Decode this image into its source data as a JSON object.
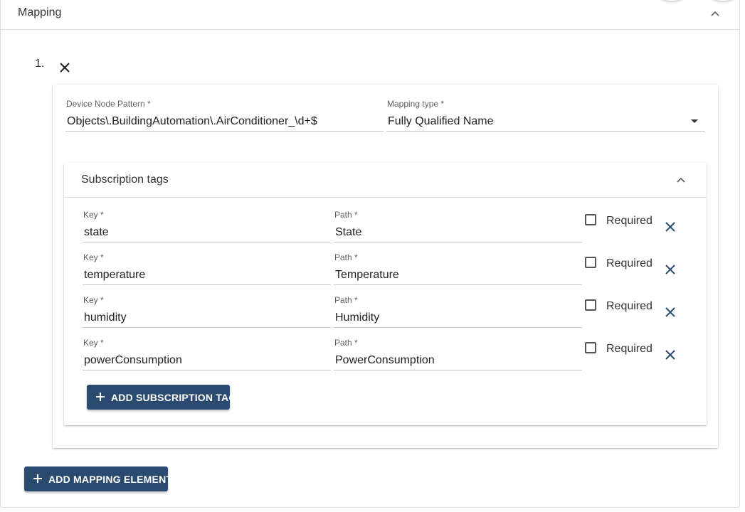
{
  "panel": {
    "title": "Mapping"
  },
  "mapping_element": {
    "number": "1.",
    "device_node_pattern": {
      "label": "Device Node Pattern *",
      "value": "Objects\\.BuildingAutomation\\.AirConditioner_\\d+$"
    },
    "mapping_type": {
      "label": "Mapping type *",
      "value": "Fully Qualified Name"
    },
    "subscription_tags": {
      "title": "Subscription tags",
      "key_label": "Key *",
      "path_label": "Path *",
      "required_label": "Required",
      "rows": [
        {
          "key": "state",
          "path": "State",
          "required": false
        },
        {
          "key": "temperature",
          "path": "Temperature",
          "required": false
        },
        {
          "key": "humidity",
          "path": "Humidity",
          "required": false
        },
        {
          "key": "powerConsumption",
          "path": "PowerConsumption",
          "required": false
        }
      ],
      "add_button_label": "ADD SUBSCRIPTION TAG"
    }
  },
  "add_mapping_button_label": "ADD MAPPING ELEMENT",
  "colors": {
    "accent": "#2b4a6f",
    "remove_icon": "#2b4a6f"
  }
}
